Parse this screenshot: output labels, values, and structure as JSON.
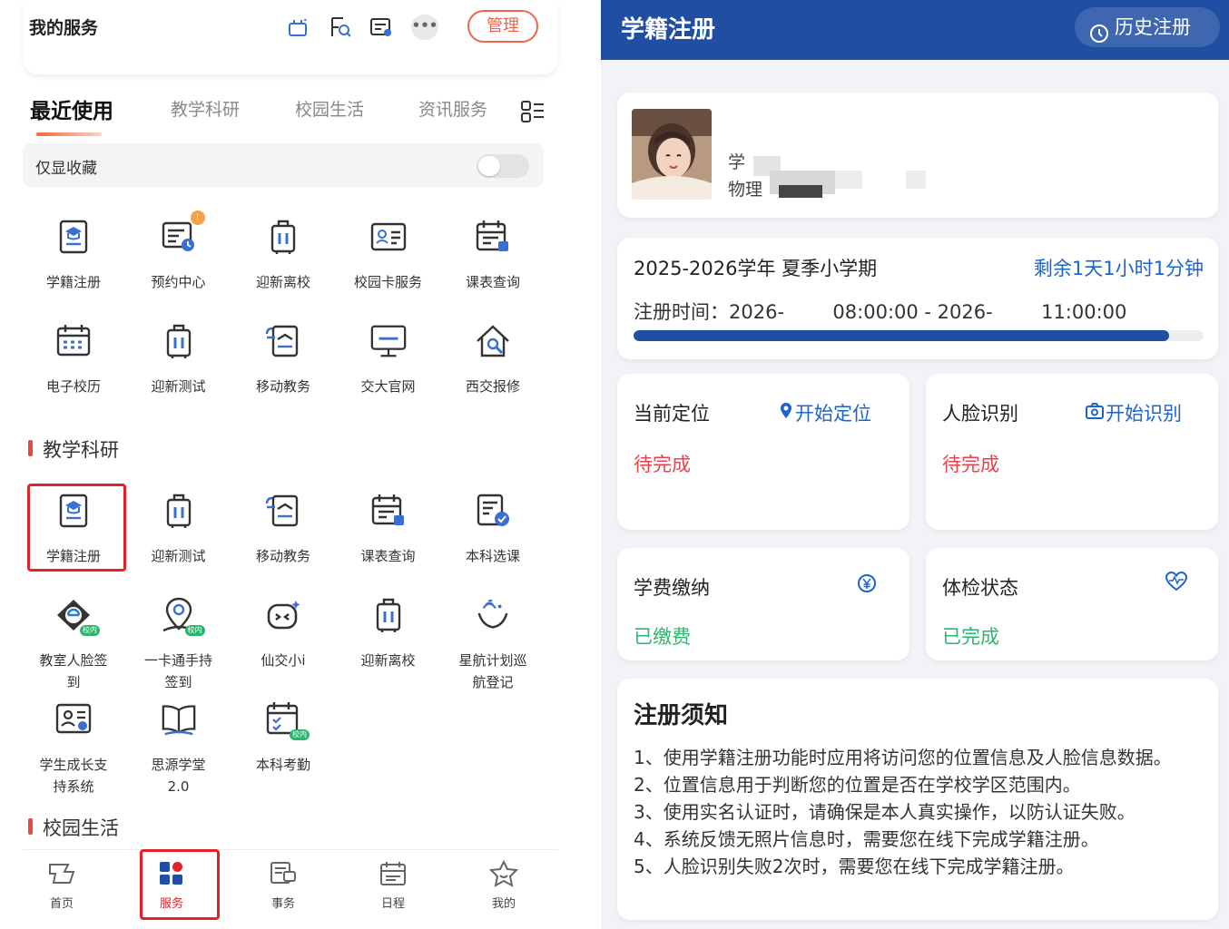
{
  "left": {
    "header_title": "我的服务",
    "manage_label": "管理",
    "more_label": "•••",
    "tabs": [
      "最近使用",
      "教学科研",
      "校园生活",
      "资讯服务"
    ],
    "fav_label": "仅显收藏",
    "recent": [
      {
        "label": "学籍注册",
        "icon": "student-register-icon"
      },
      {
        "label": "预约中心",
        "icon": "appointment-icon",
        "badge": "!"
      },
      {
        "label": "迎新离校",
        "icon": "luggage-icon"
      },
      {
        "label": "校园卡服务",
        "icon": "campus-card-icon"
      },
      {
        "label": "课表查询",
        "icon": "schedule-icon"
      },
      {
        "label": "电子校历",
        "icon": "calendar-icon"
      },
      {
        "label": "迎新测试",
        "icon": "luggage-test-icon"
      },
      {
        "label": "移动教务",
        "icon": "mobile-affairs-icon"
      },
      {
        "label": "交大官网",
        "icon": "monitor-icon"
      },
      {
        "label": "西交报修",
        "icon": "repair-house-icon"
      }
    ],
    "section1_title": "教学科研",
    "research": [
      {
        "label": "学籍注册",
        "icon": "student-register-icon"
      },
      {
        "label": "迎新测试",
        "icon": "luggage-test-icon"
      },
      {
        "label": "移动教务",
        "icon": "mobile-affairs-icon"
      },
      {
        "label": "课表查询",
        "icon": "schedule-icon"
      },
      {
        "label": "本科选课",
        "icon": "course-select-icon"
      },
      {
        "label": "教室人脸签\n到",
        "icon": "face-checkin-icon",
        "mini": "校内"
      },
      {
        "label": "一卡通手持\n签到",
        "icon": "location-checkin-icon",
        "mini": "校内"
      },
      {
        "label": "仙交小i",
        "icon": "assistant-bot-icon"
      },
      {
        "label": "迎新离校",
        "icon": "luggage-icon"
      },
      {
        "label": "星航计划巡\n航登记",
        "icon": "star-plan-icon"
      },
      {
        "label": "学生成长支\n持系统",
        "icon": "growth-support-icon"
      },
      {
        "label": "思源学堂\n2.0",
        "icon": "book-icon"
      },
      {
        "label": "本科考勤",
        "icon": "attendance-icon",
        "mini": "校内"
      }
    ],
    "section2_title": "校园生活",
    "nav": [
      {
        "label": "首页",
        "icon": "home-icon"
      },
      {
        "label": "服务",
        "icon": "service-grid-icon"
      },
      {
        "label": "事务",
        "icon": "affairs-icon"
      },
      {
        "label": "日程",
        "icon": "agenda-icon"
      },
      {
        "label": "我的",
        "icon": "profile-icon"
      }
    ]
  },
  "right": {
    "title": "学籍注册",
    "history_label": "历史注册",
    "profile_line1": "学",
    "profile_line2": "物理",
    "term": "2025-2026学年 夏季小学期",
    "remaining": "剩余1天1小时1分钟",
    "reg_time": "注册时间：2026-        08:00:00 - 2026-        11:00:00",
    "progress": 0.94,
    "location": {
      "title": "当前定位",
      "action": "开始定位",
      "status": "待完成"
    },
    "face": {
      "title": "人脸识别",
      "action": "开始识别",
      "status": "待完成"
    },
    "fee": {
      "title": "学费缴纳",
      "status": "已缴费"
    },
    "health": {
      "title": "体检状态",
      "status": "已完成"
    },
    "notice_title": "注册须知",
    "notice_items": [
      "1、使用学籍注册功能时应用将访问您的位置信息及人脸信息数据。",
      "2、位置信息用于判断您的位置是否在学校学区范围内。",
      "3、使用实名认证时，请确保是本人真实操作，以防认证失败。",
      "4、系统反馈无照片信息时，需要您在线下完成学籍注册。",
      "5、人脸识别失败2次时，需要您在线下完成学籍注册。"
    ],
    "colors": {
      "primary": "#1f4ea3",
      "link": "#1e63c8",
      "pending": "#ee3f4d",
      "done": "#2db46e"
    }
  }
}
